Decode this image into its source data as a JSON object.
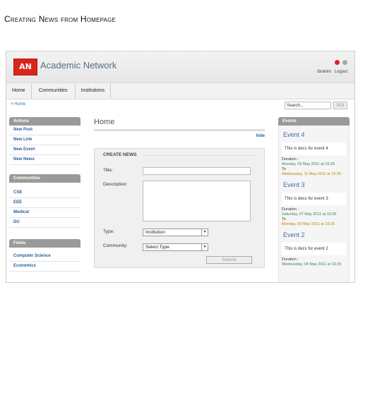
{
  "doc_title": "Creating News from Homepage",
  "app": {
    "logo_text": "AN",
    "name": "Academic Network",
    "user": "ibrahim",
    "logout": "Logout"
  },
  "nav": [
    "Home",
    "Communities",
    "Institutions"
  ],
  "breadcrumb": "> Home",
  "search": {
    "placeholder": "Search...",
    "go": "GO!"
  },
  "sidebar": {
    "actions_title": "Actions",
    "actions": [
      "New Post",
      "New Link",
      "New Event",
      "New News"
    ],
    "communities_title": "Communities",
    "communities": [
      "CSE",
      "EEE",
      "Medical",
      "DU"
    ],
    "fields_title": "Fields",
    "fields": [
      "Computer Science",
      "Economics"
    ]
  },
  "main": {
    "title": "Home",
    "hide": "hide",
    "form": {
      "heading": "CREATE NEWS",
      "title_label": "Title:",
      "description_label": "Description:",
      "type_label": "Type:",
      "type_value": "Institution",
      "community_label": "Community:",
      "community_value": "Select Type",
      "submit": "Submit"
    }
  },
  "events": {
    "heading": "Events",
    "items": [
      {
        "title": "Event 4",
        "desc": "This is decs for event 4",
        "duration_label": "Duration :",
        "start": "Monday, 09 May 2011 at 19:26",
        "to": "To",
        "end": "Wednesday, 11 May 2011 at 19:26"
      },
      {
        "title": "Event 3",
        "desc": "This is decs for event 3",
        "duration_label": "Duration :",
        "start": "Saturday, 07 May 2011 at 19:25",
        "to": "To",
        "end": "Monday, 09 May 2011 at 19:25"
      },
      {
        "title": "Event 2",
        "desc": "This is decs for event 2",
        "duration_label": "Duration :",
        "start": "Wednesday, 04 May 2011 at 19:25",
        "to": "",
        "end": ""
      }
    ]
  },
  "colors": {
    "logo": "#d7261c",
    "link": "#2c5e9e",
    "sidebar_header": "#9a9a9a"
  }
}
